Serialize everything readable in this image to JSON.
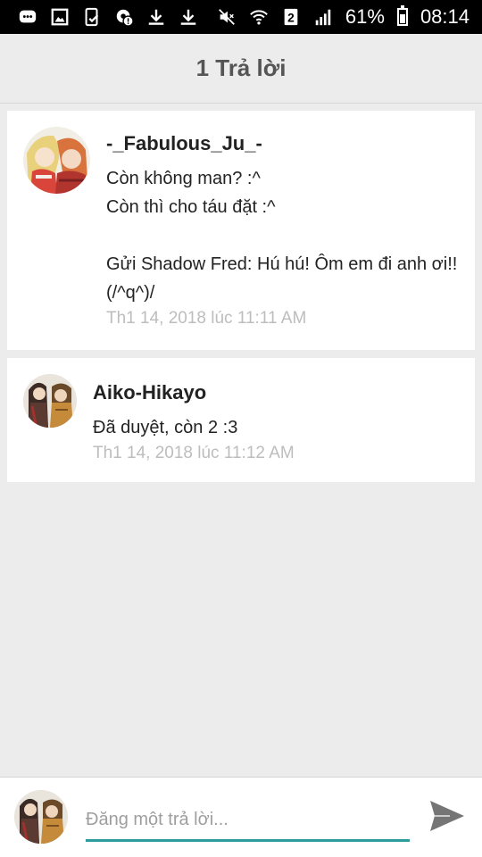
{
  "status_bar": {
    "left_icons": [
      "message-icon",
      "image-icon",
      "phone-check-icon",
      "settings-alert-icon",
      "download-icon",
      "download-icon"
    ],
    "right_icons": [
      "mute-icon",
      "wifi-icon",
      "sim-2-icon",
      "signal-icon"
    ],
    "sim_label": "2",
    "battery": "61%",
    "time": "08:14"
  },
  "header": {
    "title": "1 Trả lời"
  },
  "comments": [
    {
      "author": "-_Fabulous_Ju_-",
      "lines": [
        "Còn không man? :^",
        "Còn thì cho táu đặt :^",
        "",
        "Gửi Shadow Fred: Hú hú! Ôm em đi anh ơi!!",
        "(/^q^)/"
      ],
      "time": "Th1 14, 2018 lúc 11:11 AM"
    },
    {
      "author": "Aiko-Hikayo",
      "lines": [
        "Đã duyệt, còn 2 :3"
      ],
      "time": "Th1 14, 2018 lúc 11:12 AM"
    }
  ],
  "reply": {
    "placeholder": "Đăng một trả lời..."
  },
  "colors": {
    "accent": "#2e9c9c",
    "send_icon": "#757575",
    "timestamp": "#bdbdbd",
    "background": "#ececec"
  }
}
